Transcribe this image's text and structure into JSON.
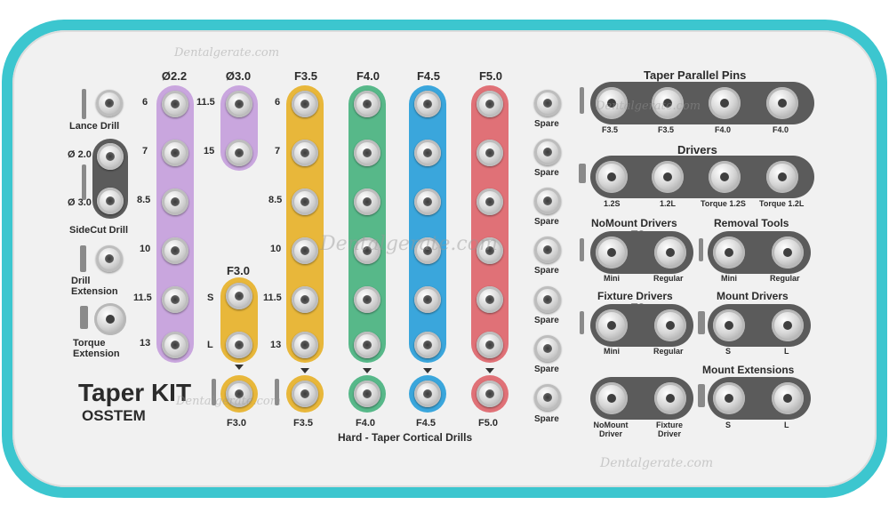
{
  "kit": {
    "title": "Taper KIT",
    "brand": "OSSTEM",
    "bottom_caption": "Hard - Taper Cortical Drills"
  },
  "left": {
    "lance": "Lance Drill",
    "d20": "Ø 2.0",
    "d30": "Ø 3.0",
    "sidecut": "SideCut Drill",
    "drill_ext": "Drill\nExtension",
    "torque_ext": "Torque\nExtension"
  },
  "columns": {
    "d22": "Ø2.2",
    "d30": "Ø3.0",
    "f35": "F3.5",
    "f40": "F4.0",
    "f45": "F4.5",
    "f50": "F5.0",
    "f30": "F3.0"
  },
  "depths": [
    "6",
    "7",
    "8.5",
    "10",
    "11.5",
    "13"
  ],
  "d30_depths": [
    "11.5",
    "15"
  ],
  "f30_sizes": [
    "S",
    "L"
  ],
  "cortical": [
    "F3.0",
    "F3.5",
    "F4.0",
    "F4.5",
    "F5.0"
  ],
  "spare_label": "Spare",
  "right": {
    "pins_title": "Taper Parallel Pins",
    "pins": [
      "F3.5",
      "F3.5",
      "F4.0",
      "F4.0"
    ],
    "drivers_title": "Drivers",
    "drivers": [
      "1.2S",
      "1.2L",
      "Torque 1.2S",
      "Torque 1.2L"
    ],
    "nomount_title": "NoMount Drivers",
    "ts": "TS",
    "removal_title": "Removal Tools",
    "mini": "Mini",
    "regular": "Regular",
    "fixture_title": "Fixture Drivers",
    "mount_title": "Mount Drivers",
    "ss": "SS",
    "mount_ext_title": "Mount Extensions",
    "s": "S",
    "l": "L",
    "nomount_driver": "NoMount\nDriver",
    "fixture_driver": "Fixture\nDriver"
  },
  "watermark": "Dentalgerate.com",
  "colors": {
    "tray_rim": "#3cc6cf",
    "purple": "#c9a6de",
    "orange": "#e8b73a",
    "green": "#57b889",
    "blue": "#3aa6dc",
    "red": "#e07177",
    "dark_plate": "#5b5b5b"
  }
}
